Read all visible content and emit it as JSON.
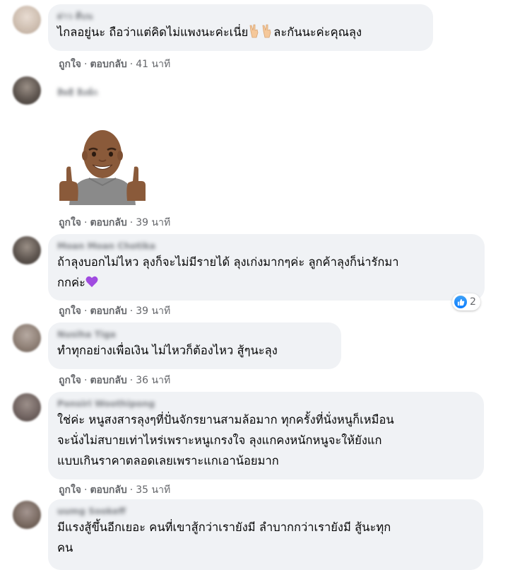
{
  "comments": [
    {
      "author": "ผ่าว ตีบน",
      "text": "ไกลอยู่นะ ถือว่าแต่คิดไม่แพงนะค่ะเนี่ย",
      "text_after_emoji": "ละกันนะค่ะคุณลุง",
      "emoji": [
        "victory-hand-emoji",
        "victory-hand-emoji"
      ],
      "like_label": "ถูกใจ",
      "reply_label": "ตอบกลับ",
      "time": "41 นาที"
    },
    {
      "author": "สิทธิ สิงห์ก",
      "sticker": "thumbs-up-avatar-sticker",
      "like_label": "ถูกใจ",
      "reply_label": "ตอบกลับ",
      "time": "39 นาที"
    },
    {
      "author": "Moan Moan Chotika",
      "text_line1": "ถ้าลุงบอกไม่ไหว ลุงก็จะไม่มีรายได้ ลุงเก่งมากๆค่ะ ลูกค้าลุงก็น่ารักมา",
      "text_line2": "กกค่ะ",
      "emoji": "purple-heart-emoji",
      "like_label": "ถูกใจ",
      "reply_label": "ตอบกลับ",
      "time": "39 นาที",
      "reaction_count": "2",
      "reaction_icon": "like-icon",
      "reaction_color": "#1877f2"
    },
    {
      "author": "Nusiha Tiga",
      "text": "ทำทุกอย่างเพื่อเงิน ไม่ไหวก็ต้องไหว สู้ๆนะลุง",
      "like_label": "ถูกใจ",
      "reply_label": "ตอบกลับ",
      "time": "36 นาที"
    },
    {
      "author": "Ponsiri Woothipong",
      "text_line1": "ใช่ค่ะ หนูสงสารลุงๆที่ปั่นจักรยานสามล้อมาก ทุกครั้งที่นั่งหนูก็เหมือน",
      "text_line2": "จะนั่งไม่สบายเท่าไหร่เพราะหนูเกรงใจ ลุงแกคงหนักหนูจะให้ยังแก",
      "text_line3": "แบบเกินราคาตลอดเลยเพราะแกเอาน้อยมาก",
      "like_label": "ถูกใจ",
      "reply_label": "ตอบกลับ",
      "time": "35 นาที"
    },
    {
      "author": "uumg Sookeff",
      "text_line1": "มีแรงสู้ขึ้นอีกเยอะ คนที่เขาสู้กว่าเรายังมี ลำบากกว่าเรายังมี สู้นะทุก",
      "text_line2": "คน"
    }
  ]
}
